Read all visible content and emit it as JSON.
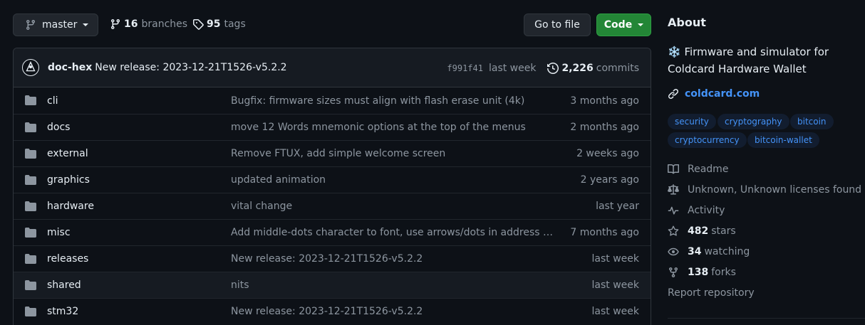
{
  "toolbar": {
    "branch": "master",
    "branches_count": "16",
    "branches_label": "branches",
    "tags_count": "95",
    "tags_label": "tags",
    "go_to_file": "Go to file",
    "code": "Code"
  },
  "latest_commit": {
    "author": "doc-hex",
    "message": "New release: 2023-12-21T1526-v5.2.2",
    "sha": "f991f41",
    "date": "last week",
    "commits_count": "2,226",
    "commits_label": "commits"
  },
  "files": [
    {
      "name": "cli",
      "message": "Bugfix: firmware sizes must align with flash erase unit (4k)",
      "date": "3 months ago"
    },
    {
      "name": "docs",
      "message": "move 12 Words mnemonic options at the top of the menus",
      "date": "2 months ago"
    },
    {
      "name": "external",
      "message": "Remove FTUX, add simple welcome screen",
      "date": "2 weeks ago"
    },
    {
      "name": "graphics",
      "message": "updated animation",
      "date": "2 years ago"
    },
    {
      "name": "hardware",
      "message": "vital change",
      "date": "last year"
    },
    {
      "name": "misc",
      "message": "Add middle-dots character to font, use arrows/dots in address expl…",
      "date": "7 months ago"
    },
    {
      "name": "releases",
      "message": "New release: 2023-12-21T1526-v5.2.2",
      "date": "last week"
    },
    {
      "name": "shared",
      "message": "nits",
      "date": "last week"
    },
    {
      "name": "stm32",
      "message": "New release: 2023-12-21T1526-v5.2.2",
      "date": "last week"
    }
  ],
  "about": {
    "heading": "About",
    "description_icon": "❄️",
    "description": "Firmware and simulator for Coldcard Hardware Wallet",
    "website": "coldcard.com",
    "topics": [
      "security",
      "cryptography",
      "bitcoin",
      "cryptocurrency",
      "bitcoin-wallet"
    ],
    "readme": "Readme",
    "license": "Unknown, Unknown licenses found",
    "activity": "Activity",
    "stars_count": "482",
    "stars_label": "stars",
    "watching_count": "34",
    "watching_label": "watching",
    "forks_count": "138",
    "forks_label": "forks",
    "report": "Report repository"
  },
  "colors": {
    "background": "#0d1117",
    "accent_green": "#238636",
    "link_blue": "#4493f8",
    "muted": "#8d96a0"
  }
}
